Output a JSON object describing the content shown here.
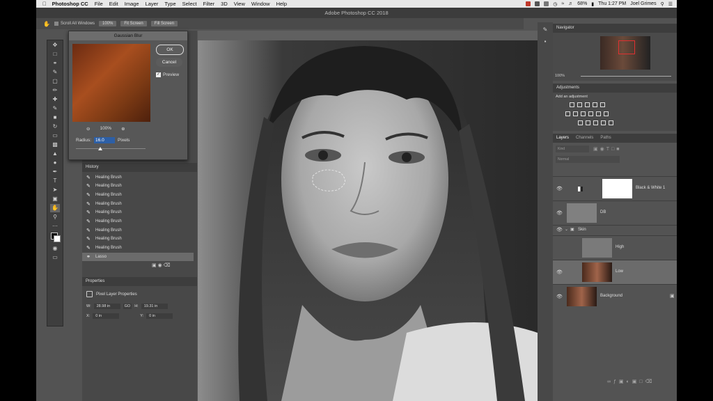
{
  "menubar": {
    "app_name": "Photoshop CC",
    "items": [
      "File",
      "Edit",
      "Image",
      "Layer",
      "Type",
      "Select",
      "Filter",
      "3D",
      "View",
      "Window",
      "Help"
    ],
    "battery": "68%",
    "clock": "Thu 1:27 PM",
    "user": "Joel Grimes"
  },
  "window": {
    "title": "Adobe Photoshop CC 2018"
  },
  "options_bar": {
    "scroll_all": "Scroll All Windows",
    "zoom_100": "100%",
    "fit_screen": "Fit Screen",
    "fill_screen": "Fill Screen"
  },
  "dialog": {
    "title": "Gaussian Blur",
    "ok": "OK",
    "cancel": "Cancel",
    "preview": "Preview",
    "zoom": "100%",
    "radius_label": "Radius:",
    "radius_value": "16.0",
    "radius_unit": "Pixels",
    "radius_slider_fraction": 0.35
  },
  "history": {
    "title": "History",
    "items": [
      "Healing Brush",
      "Healing Brush",
      "Healing Brush",
      "Healing Brush",
      "Healing Brush",
      "Healing Brush",
      "Healing Brush",
      "Healing Brush",
      "Healing Brush"
    ],
    "last_item": "Lasso"
  },
  "properties": {
    "title": "Properties",
    "subtitle": "Pixel Layer Properties",
    "w_label": "W:",
    "w_value": "28.98 in",
    "link": "GO",
    "h_label": "H:",
    "h_value": "19.31 in",
    "x_label": "X:",
    "x_value": "0 in",
    "y_label": "Y:",
    "y_value": "0 in"
  },
  "navigator": {
    "title": "Navigator",
    "zoom": "100%"
  },
  "adjustments": {
    "title": "Adjustments",
    "subtitle": "Add an adjustment"
  },
  "layers_panel": {
    "tabs": [
      "Layers",
      "Channels",
      "Paths"
    ],
    "kind": "Kind",
    "blend": "Normal",
    "layers": [
      {
        "name": "Black & White 1"
      },
      {
        "name": "DB"
      },
      {
        "name": "Skin"
      },
      {
        "name": "High"
      },
      {
        "name": "Low"
      },
      {
        "name": "Background"
      }
    ]
  },
  "colors": {
    "accent": "#3a8ee6",
    "panel": "#4a4a4a",
    "selected_layer": "#6b6b6b"
  }
}
